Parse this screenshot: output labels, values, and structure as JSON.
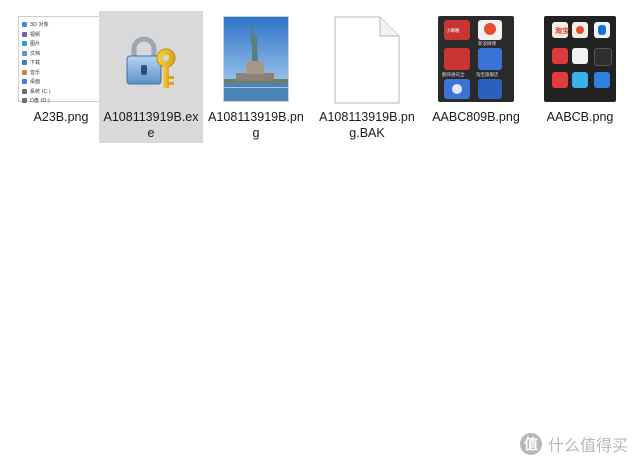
{
  "files": [
    {
      "name": "A23B.png",
      "icon": "explorer-screenshot-thumbnail"
    },
    {
      "name": "A108113919B.exe",
      "icon": "lock-key-icon",
      "selected": true
    },
    {
      "name": "A108113919B.png",
      "icon": "statue-of-liberty-thumbnail"
    },
    {
      "name": "A108113919B.png.BAK",
      "icon": "blank-document-icon"
    },
    {
      "name": "AABC809B.png",
      "icon": "phone-screen-thumbnail"
    },
    {
      "name": "AABCB.png",
      "icon": "phone-screen-thumbnail"
    }
  ],
  "explorer_thumb": {
    "items": [
      "3D 对象",
      "视频",
      "图片",
      "文档",
      "下载",
      "音乐",
      "桌面",
      "系统 (C:)",
      "D盘 (D:)"
    ],
    "colors": [
      "#3b8fd6",
      "#7b5ea8",
      "#2f9be0",
      "#5d8fcc",
      "#2f7fd0",
      "#d9822b",
      "#3c7fd8",
      "#6d6d6d",
      "#6d6d6d"
    ]
  },
  "phone1": {
    "labels": [
      "小喇喔",
      "新浪微博",
      "翻译通讯全",
      "淘宝旗舰店",
      "蓝色按钮",
      "在线播放"
    ]
  },
  "phone2": {
    "labels": [
      "淘宝",
      "微博",
      "知乎",
      "小红书",
      "手机助手"
    ]
  },
  "brand": {
    "badge": "值",
    "text": "什么值得买"
  }
}
